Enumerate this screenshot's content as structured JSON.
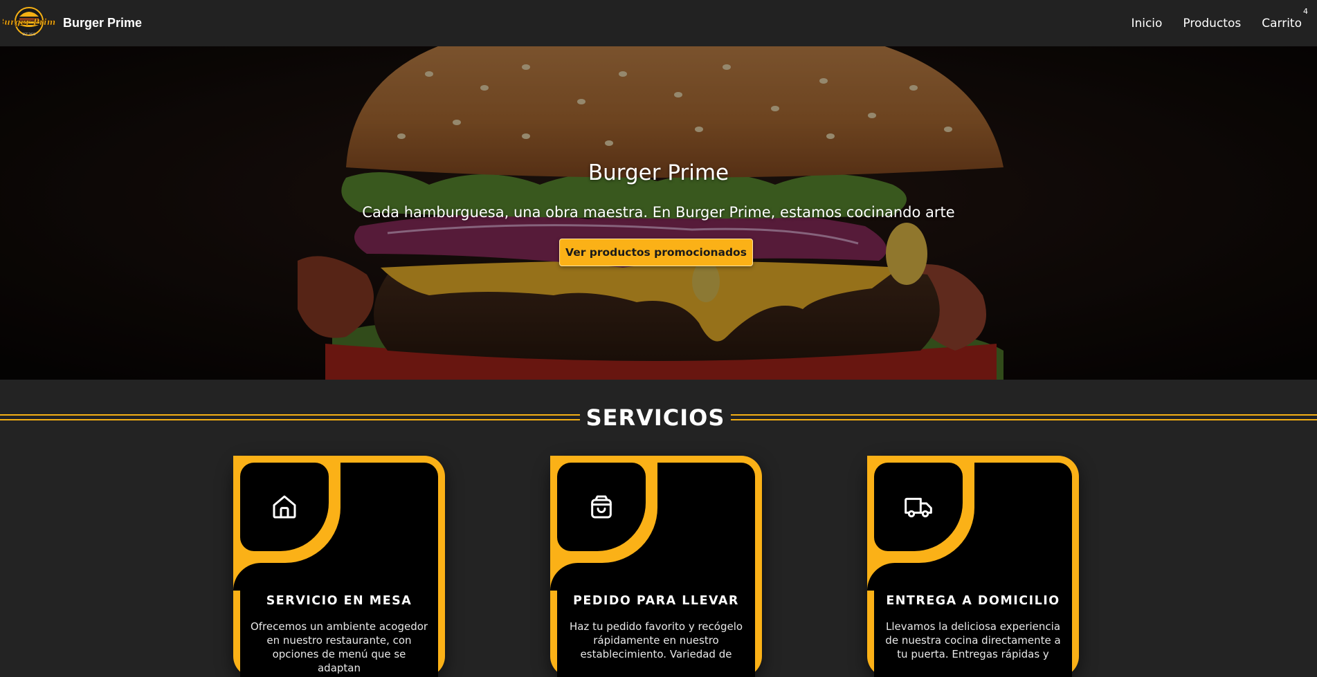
{
  "nav": {
    "brand": "Burger Prime",
    "logo_text": "Burger Prime",
    "links": [
      {
        "label": "Inicio"
      },
      {
        "label": "Productos"
      },
      {
        "label": "Carrito"
      }
    ],
    "cart_count": "4"
  },
  "hero": {
    "title": "Burger Prime",
    "subtitle": "Cada hamburguesa, una obra maestra. En Burger Prime, estamos cocinando arte",
    "button_label": "Ver productos promocionados"
  },
  "services": {
    "title": "SERVICIOS",
    "cards": [
      {
        "icon": "house-icon",
        "title": "SERVICIO EN MESA",
        "text": "Ofrecemos un ambiente acogedor en nuestro restaurante, con opciones de menú que se adaptan"
      },
      {
        "icon": "shopping-bag-icon",
        "title": "PEDIDO PARA LLEVAR",
        "text": "Haz tu pedido favorito y recógelo rápidamente en nuestro establecimiento. Variedad de"
      },
      {
        "icon": "delivery-truck-icon",
        "title": "ENTREGA A DOMICILIO",
        "text": "Llevamos la deliciosa experiencia de nuestra cocina directamente a tu puerta. Entregas rápidas y"
      }
    ]
  },
  "colors": {
    "accent": "#fbb117",
    "nav_bg": "#222222",
    "page_bg": "#232323",
    "card_inner": "#000000"
  }
}
